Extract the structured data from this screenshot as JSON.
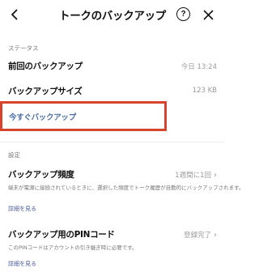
{
  "header": {
    "title": "トークのバックアップ",
    "back_icon": "chevron-left-icon",
    "help_icon": "question-circle-icon",
    "help_glyph": "?",
    "close_icon": "close-icon"
  },
  "status_section": {
    "label": "ステータス",
    "last_backup": {
      "label": "前回のバックアップ",
      "value": "今日 13:24"
    },
    "backup_size": {
      "label": "バックアップサイズ",
      "value": "123 KB"
    },
    "backup_now": {
      "label": "今すぐバックアップ"
    }
  },
  "settings_section": {
    "label": "設定",
    "frequency": {
      "label": "バックアップ頻度",
      "value": "1週間に1回",
      "chevron": "›",
      "description": "端末が電源に接続されているときに、選択した頻度でトーク履歴が自動的にバックアップされます。",
      "detail_link": "詳細を見る"
    },
    "pin": {
      "label": "バックアップ用のPINコード",
      "value": "登録完了",
      "chevron": "›",
      "description": "このPINコードはアカウントの引き継ぎ時に必要です。",
      "detail_link": "詳細を見る"
    }
  },
  "colors": {
    "highlight_border": "#d6452b",
    "link": "#4a6fa8"
  }
}
